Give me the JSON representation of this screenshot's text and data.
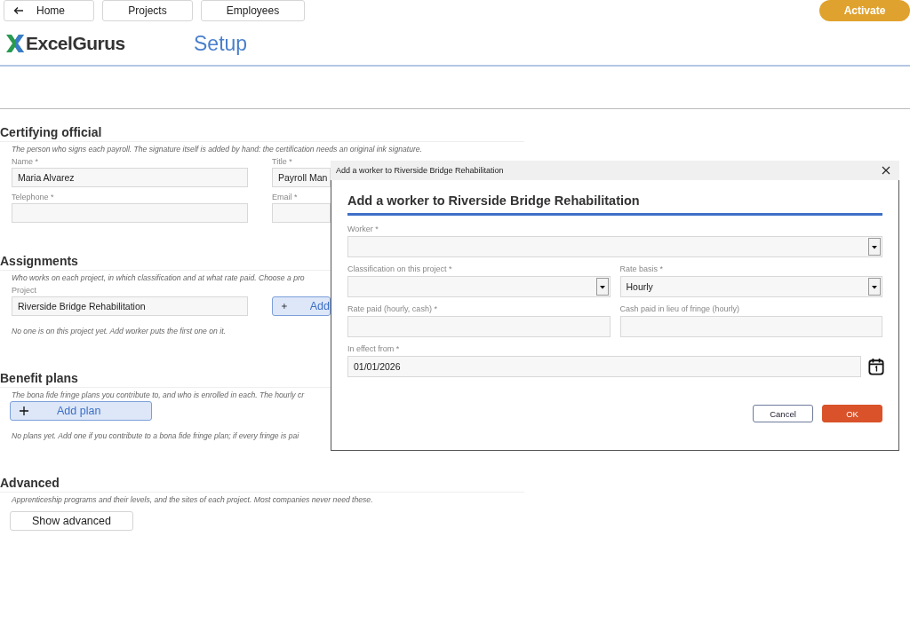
{
  "nav": {
    "buttons": [
      {
        "label": "Home",
        "kind": "back"
      },
      {
        "label": "Projects",
        "kind": "plain"
      },
      {
        "label": "Employees",
        "kind": "plain"
      }
    ],
    "activate": "Activate"
  },
  "header": {
    "logo": "ExcelGurus",
    "title": "Setup"
  },
  "certifying": {
    "heading": "Certifying official",
    "description": "The person who signs each payroll. The signature itself is added by hand: the certification needs an original ink signature.",
    "fields": [
      {
        "label": "Name *",
        "value": "Maria Alvarez"
      },
      {
        "label": "Title *",
        "value": "Payroll Man"
      },
      {
        "label": "Telephone *"
      },
      {
        "label": "Email *"
      }
    ]
  },
  "assignments": {
    "heading": "Assignments",
    "description": "Who works on each project, in which classification and at what rate paid. Choose a pro",
    "project": {
      "label": "Project",
      "value": "Riverside Bridge Rehabilitation"
    },
    "add_button": "Add",
    "note": "No one is on this project yet. Add worker puts the first one on it."
  },
  "benefit_plans": {
    "heading": "Benefit plans",
    "description": "The bona fide fringe plans you contribute to, and who is enrolled in each. The hourly cr",
    "add_button": "Add plan",
    "note": "No plans yet. Add one if you contribute to a bona fide fringe plan; if every fringe is pai"
  },
  "advanced": {
    "heading": "Advanced",
    "description": "Apprenticeship programs and their levels, and the sites of each project. Most companies never need these.",
    "button": "Show advanced"
  },
  "dialog": {
    "window_title": "Add a worker to Riverside Bridge Rehabilitation",
    "heading": "Add a worker to Riverside Bridge Rehabilitation",
    "rows": [
      [
        {
          "label": "Worker *",
          "kind": "select"
        }
      ],
      [
        {
          "label": "Classification on this project *",
          "kind": "select"
        },
        {
          "label": "Rate basis *",
          "kind": "select",
          "value": "Hourly"
        }
      ],
      [
        {
          "label": "Rate paid (hourly, cash) *",
          "kind": "text"
        },
        {
          "label": "Cash paid in lieu of fringe (hourly)",
          "kind": "text"
        }
      ],
      [
        {
          "label": "In effect from *",
          "kind": "date",
          "value": "01/01/2026"
        }
      ]
    ],
    "buttons": [
      {
        "label": "Cancel",
        "kind": "secondary"
      },
      {
        "label": "OK",
        "kind": "primary"
      }
    ]
  }
}
